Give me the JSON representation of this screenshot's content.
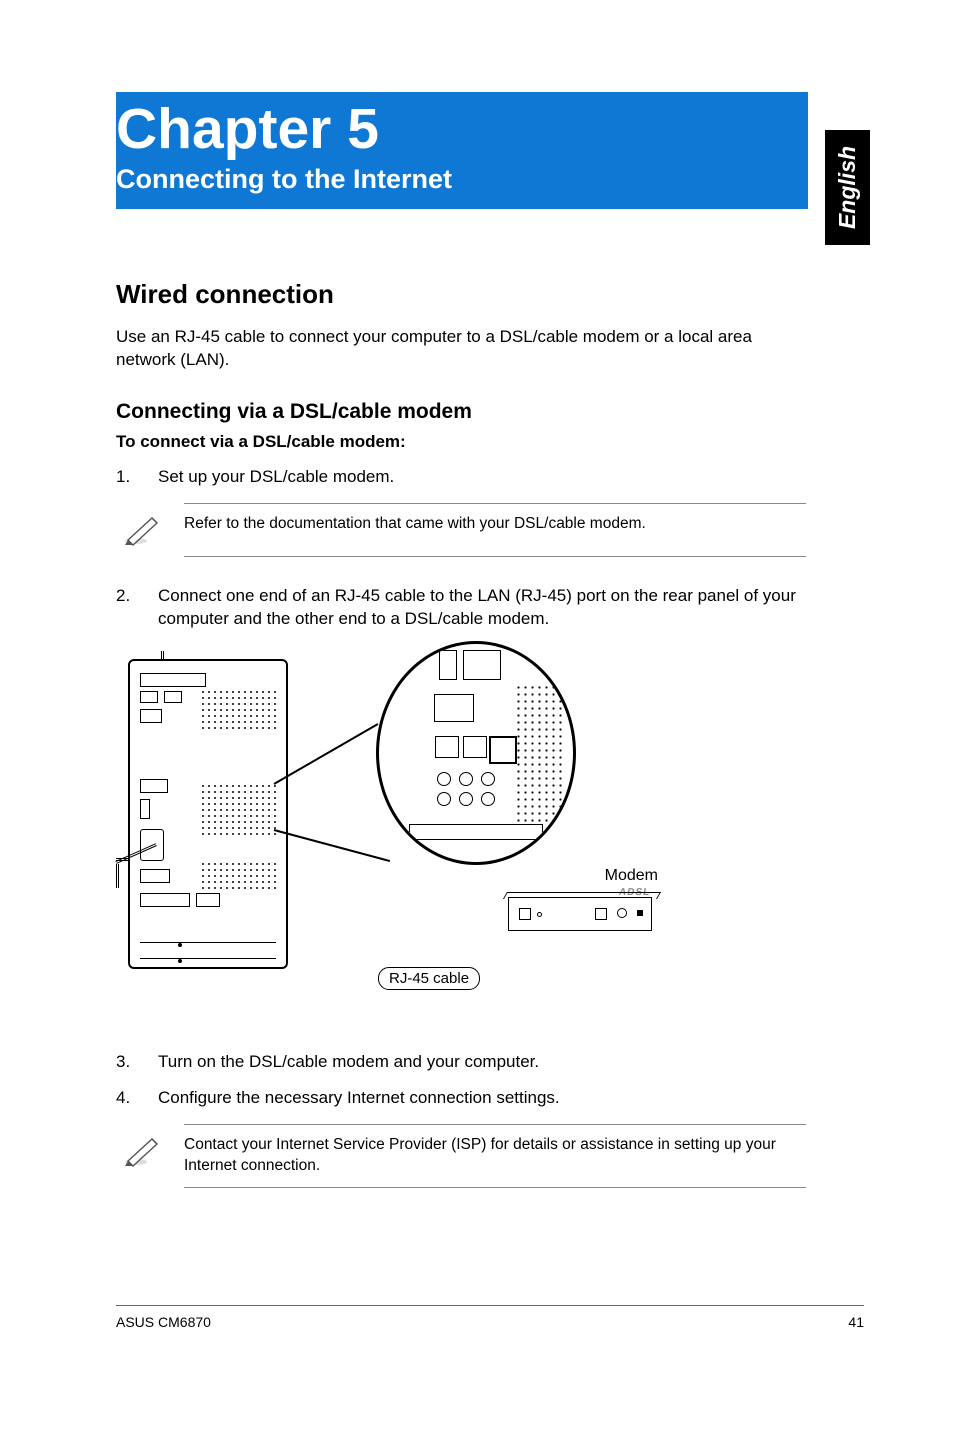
{
  "side_tab": "English",
  "chapter": {
    "title": "Chapter 5",
    "subtitle": "Connecting to the Internet"
  },
  "section": {
    "h2": "Wired connection",
    "intro": "Use an RJ-45 cable to connect your computer to a DSL/cable modem or a local area network (LAN).",
    "h3": "Connecting via a DSL/cable modem",
    "lead": "To connect via a DSL/cable modem:",
    "steps": {
      "s1_num": "1.",
      "s1": "Set up your DSL/cable modem.",
      "s2_num": "2.",
      "s2": "Connect one end of an RJ-45 cable to the LAN (RJ-45) port on the rear panel of your computer and the other end to a DSL/cable modem.",
      "s3_num": "3.",
      "s3": "Turn on the DSL/cable modem and your computer.",
      "s4_num": "4.",
      "s4": "Configure the necessary Internet connection settings."
    },
    "note1": "Refer to the documentation that came with your DSL/cable modem.",
    "note2": "Contact your Internet Service Provider (ISP) for details or assistance in setting up your Internet connection."
  },
  "diagram": {
    "modem_label": "Modem",
    "cable_label": "RJ-45 cable",
    "adsl": "ADSL"
  },
  "footer": {
    "left": "ASUS CM6870",
    "right": "41"
  }
}
